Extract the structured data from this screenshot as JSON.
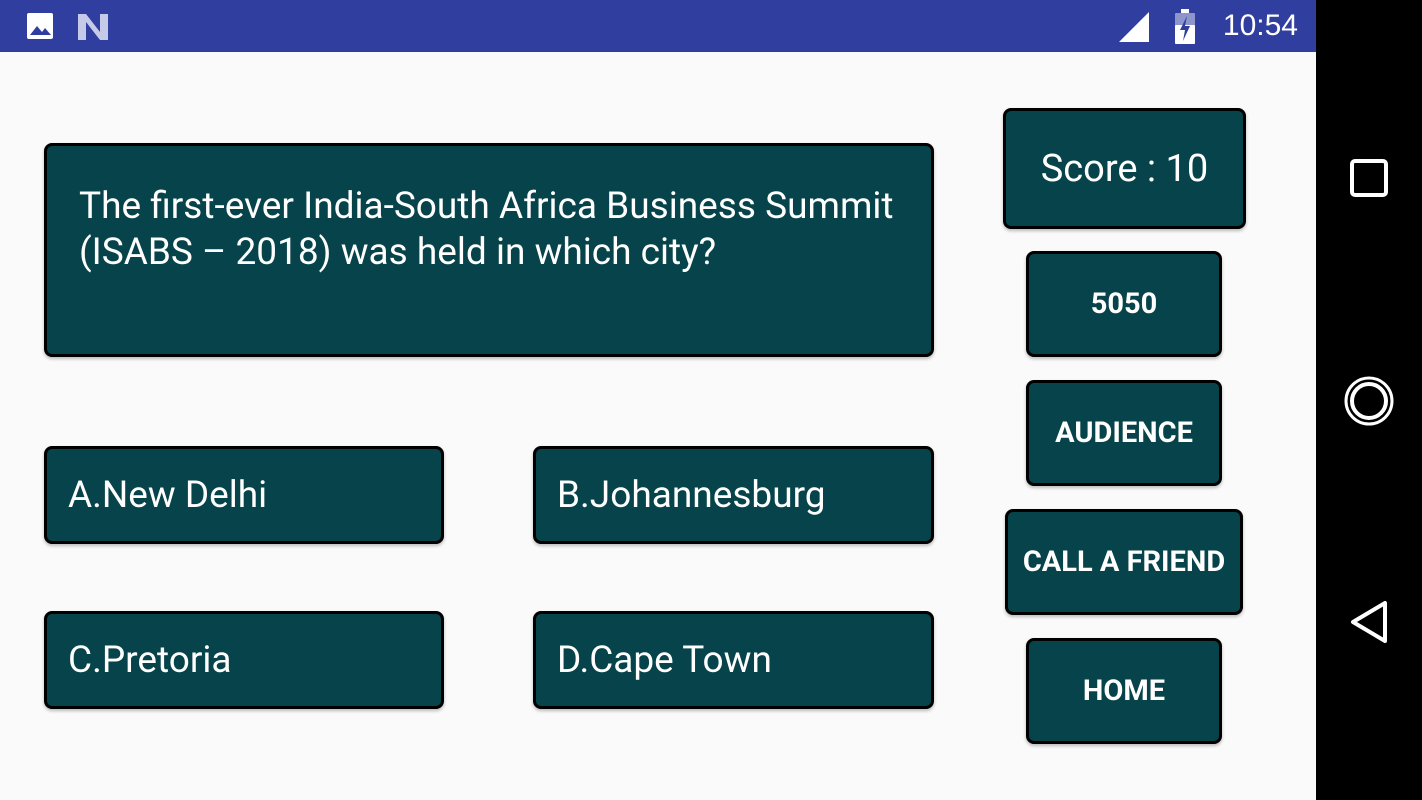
{
  "status_bar": {
    "time": "10:54",
    "icons": [
      "image-notification-icon",
      "n-notification-icon",
      "cell-signal-icon",
      "battery-charging-icon"
    ]
  },
  "nav_bar": {
    "icons": [
      "recents-square-icon",
      "home-circle-icon",
      "back-triangle-icon"
    ]
  },
  "quiz": {
    "question": "The first-ever India-South Africa Business Summit (ISABS – 2018) was held in which city?",
    "options": [
      {
        "label": "A.New Delhi"
      },
      {
        "label": "B.Johannesburg"
      },
      {
        "label": "C.Pretoria"
      },
      {
        "label": "D.Cape Town"
      }
    ],
    "score_label": "Score : 10"
  },
  "sidebar": {
    "fifty_fifty": "5050",
    "audience": "AUDIENCE",
    "call_friend": "CALL A FRIEND",
    "home": "HOME"
  },
  "colors": {
    "status_bar": "#303f9f",
    "card": "#07434a",
    "background": "#fafafa"
  }
}
